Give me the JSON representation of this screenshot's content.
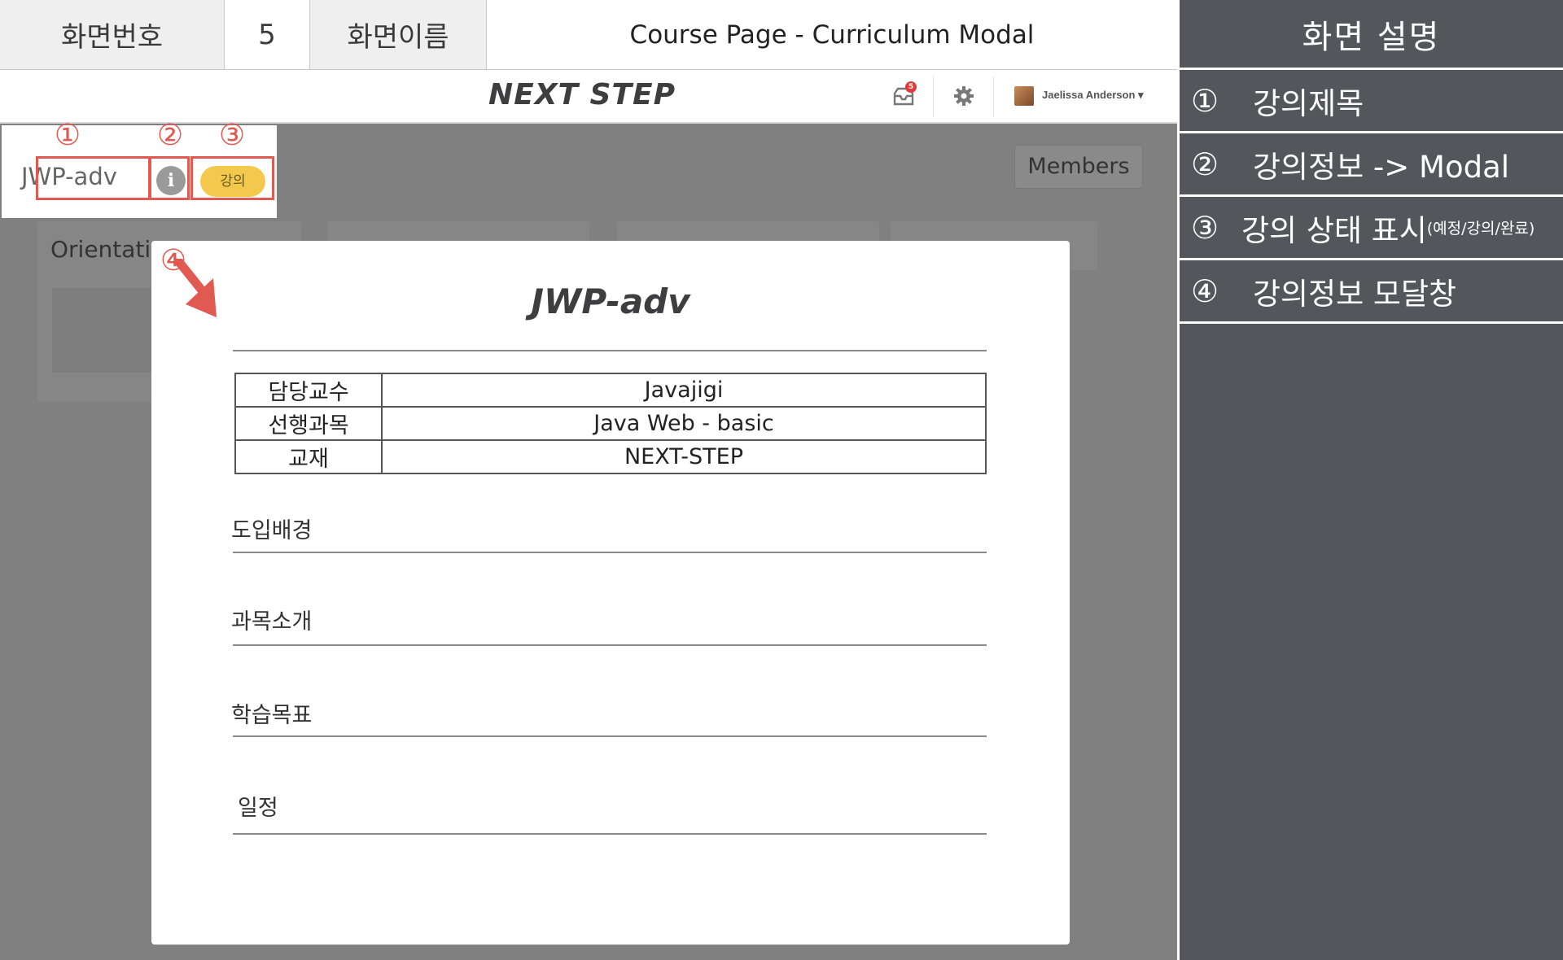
{
  "spec": {
    "screen_no_label": "화면번호",
    "screen_no_value": "5",
    "screen_name_label": "화면이름",
    "screen_name_value": "Course Page - Curriculum Modal"
  },
  "description": {
    "title": "화면 설명",
    "items": [
      {
        "num": "①",
        "text": "강의제목",
        "note": ""
      },
      {
        "num": "②",
        "text": "강의정보 -> Modal",
        "note": ""
      },
      {
        "num": "③",
        "text": "강의 상태 표시",
        "note": "(예정/강의/완료)"
      },
      {
        "num": "④",
        "text": "강의정보 모달창",
        "note": ""
      }
    ]
  },
  "navbar": {
    "logo": "NEXT STEP",
    "inbox_icon": "inbox-icon",
    "notification_count": "5",
    "settings_icon": "gear-icon",
    "user_name": "Jaelissa Anderson ▾"
  },
  "course": {
    "title": "JWP-adv",
    "info_icon_glyph": "i",
    "status": "강의",
    "members_button": "Members",
    "card_title": "Orientati"
  },
  "modal": {
    "title": "JWP-adv",
    "table": [
      {
        "label": "담당교수",
        "value": "Javajigi"
      },
      {
        "label": "선행과목",
        "value": "Java Web - basic"
      },
      {
        "label": "교재",
        "value": "NEXT-STEP"
      }
    ],
    "sections": [
      "도입배경",
      "과목소개",
      "학습목표",
      "일정"
    ]
  },
  "annotations": [
    "①",
    "②",
    "③",
    "④"
  ],
  "colors": {
    "annotation": "#e05a52",
    "panel": "#53565b",
    "overlay": "#808080",
    "status_badge": "#f2c94c"
  }
}
